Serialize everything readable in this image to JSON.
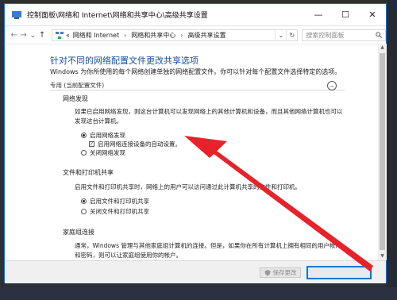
{
  "window": {
    "title": "控制面板\\网络和 Internet\\网络和共享中心\\高级共享设置"
  },
  "controls": {
    "minimize": "—",
    "maximize": "☐",
    "close": "✕"
  },
  "address": {
    "back": "←",
    "forward": "→",
    "dropdown": "⌄",
    "up": "↑",
    "breadcrumbs": [
      "网络和 Internet",
      "网络和共享中心",
      "高级共享设置"
    ],
    "prefix": "«",
    "separator": "›",
    "search_placeholder": "搜索控制面板"
  },
  "main": {
    "heading": "针对不同的网络配置文件更改共享选项",
    "subtext": "Windows 为你所使用的每个网络创建单独的网络配置文件。你可以针对每个配置文件选择特定的选项。",
    "profile_label": "专用 (当前配置文件)",
    "network_discovery": {
      "title": "网络发现",
      "description": "如果已启用网络发现，则这台计算机可以发现网络上的其他计算机和设备，而且其他网络计算机也可以发现这台计算机。",
      "options": [
        {
          "label": "启用网络发现",
          "selected": true
        },
        {
          "label": "关闭网络发现",
          "selected": false
        }
      ],
      "auto_setup_label": "启用网络连接设备的自动设置。",
      "auto_setup_checked": true
    },
    "file_sharing": {
      "title": "文件和打印机共享",
      "description": "启用文件和打印机共享时，网络上的用户可以访问通过此计算机共享的文件和打印机。",
      "options": [
        {
          "label": "启用文件和打印机共享",
          "selected": true
        },
        {
          "label": "关闭文件和打印机共享",
          "selected": false
        }
      ]
    },
    "homegroup": {
      "title": "家庭组连接",
      "description": "通常，Windows 管理与其他家庭组计算机的连接。但是，如果你在所有计算机上拥有相同的用户帐户和密码，则可以让家庭组使用你的帐户。"
    }
  },
  "footer": {
    "save_label": "保存更改",
    "cancel_label": ""
  },
  "colors": {
    "accent": "#0078d7",
    "heading": "#1a4f9c",
    "arrow": "#e8222a"
  }
}
